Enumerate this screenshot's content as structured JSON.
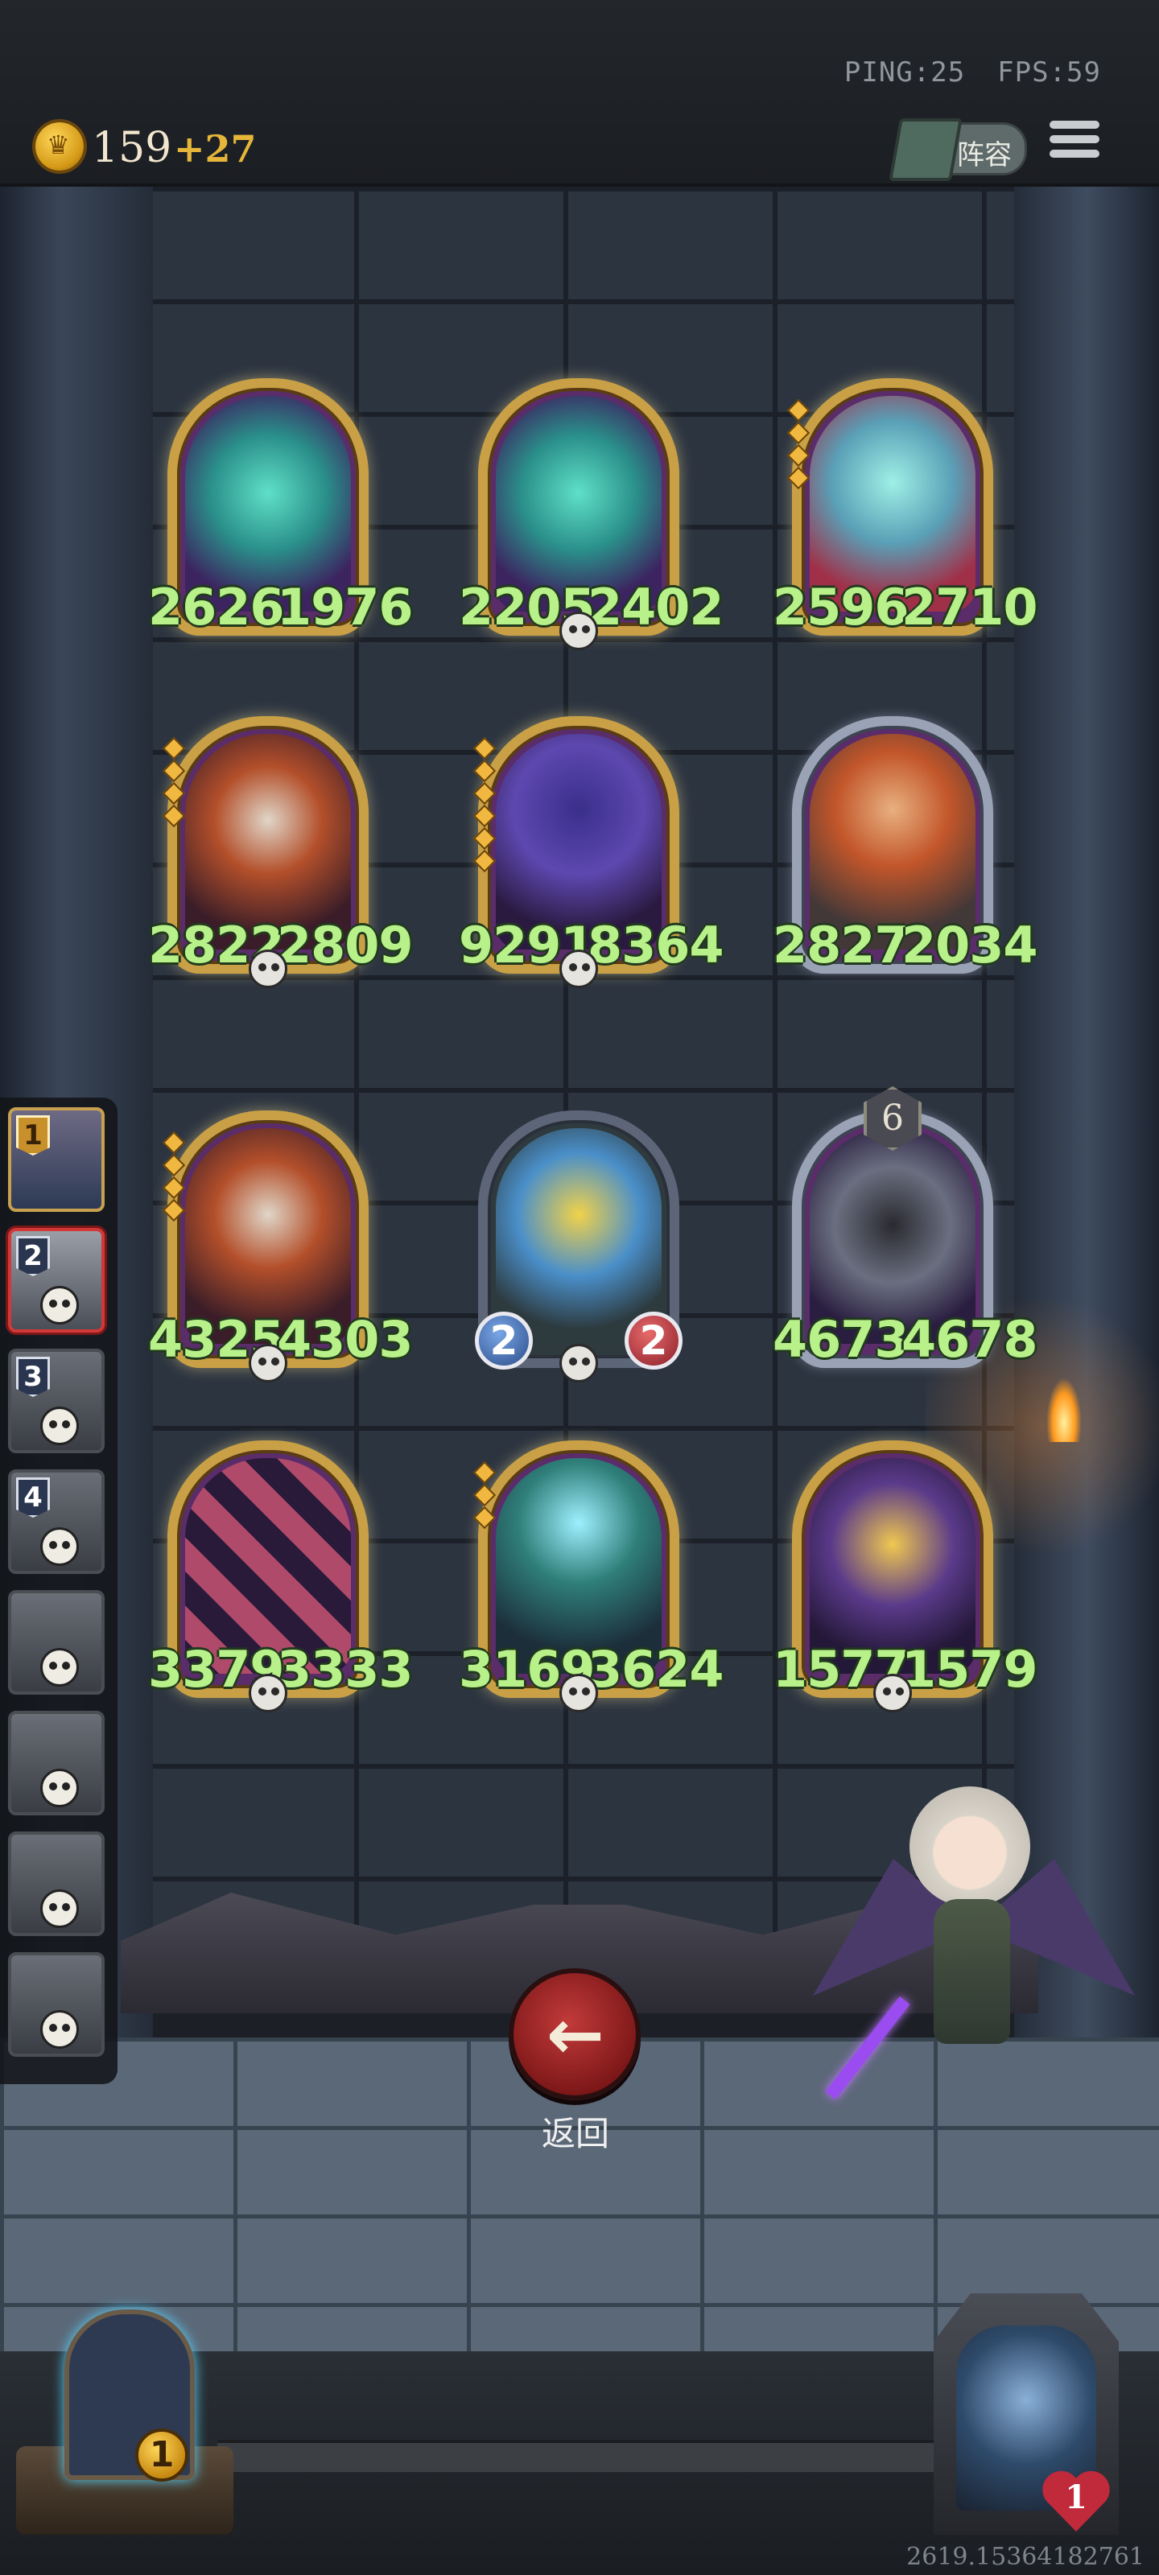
{
  "hud": {
    "ping_label": "PING:25",
    "fps_label": "FPS:59",
    "gold": "159",
    "gold_gain": "+27",
    "lineup_label": "阵容",
    "icons": {
      "coin": "crown-coin-icon",
      "lineup": "book-icon",
      "menu": "hamburger-menu-icon"
    }
  },
  "board": {
    "rows": [
      [
        {
          "name": "spectral-wolf",
          "attack": "2626",
          "health": "1976",
          "frame": "golden",
          "skull": false,
          "gems": 0
        },
        {
          "name": "spectral-wolf",
          "attack": "2205",
          "health": "2402",
          "frame": "golden",
          "skull": true,
          "gems": 0
        },
        {
          "name": "ghost-spirit",
          "attack": "2596",
          "health": "2710",
          "frame": "golden",
          "skull": false,
          "gems": 4
        }
      ],
      [
        {
          "name": "hooded-assassin",
          "attack": "2822",
          "health": "2809",
          "frame": "golden",
          "skull": true,
          "gems": 4
        },
        {
          "name": "mech-knight",
          "attack": "9291",
          "health": "8364",
          "frame": "golden",
          "skull": true,
          "gems": 6
        },
        {
          "name": "ranger",
          "attack": "2827",
          "health": "2034",
          "frame": "silver",
          "skull": false,
          "gems": 0
        }
      ],
      [
        {
          "name": "hooded-assassin",
          "attack": "4325",
          "health": "4303",
          "frame": "golden",
          "skull": true,
          "gems": 4
        },
        {
          "name": "pinocchio-puppet",
          "attack": "2",
          "health": "2",
          "frame": "plain",
          "skull": true,
          "gems": 0,
          "orbs": true
        },
        {
          "name": "shadow-beast",
          "attack": "4673",
          "health": "4678",
          "frame": "silver",
          "skull": false,
          "gems": 0,
          "tier": "6"
        }
      ],
      [
        {
          "name": "harlequin",
          "attack": "3379",
          "health": "3333",
          "frame": "golden",
          "skull": true,
          "gems": 0
        },
        {
          "name": "lantern-lich",
          "attack": "3169",
          "health": "3624",
          "frame": "golden",
          "skull": true,
          "gems": 3
        },
        {
          "name": "golden-golem",
          "attack": "1577",
          "health": "1579",
          "frame": "golden",
          "skull": true,
          "gems": 0
        }
      ]
    ]
  },
  "queue": {
    "slots": [
      {
        "number": "1",
        "state": "active"
      },
      {
        "number": "2",
        "state": "selected"
      },
      {
        "number": "3",
        "state": "eliminated"
      },
      {
        "number": "4",
        "state": "eliminated"
      },
      {
        "number": "",
        "state": "eliminated"
      },
      {
        "number": "",
        "state": "eliminated"
      },
      {
        "number": "",
        "state": "eliminated"
      },
      {
        "number": "",
        "state": "eliminated"
      }
    ]
  },
  "back_button": {
    "label": "返回",
    "icon": "arrow-left-icon"
  },
  "player": {
    "gold_badge": "1"
  },
  "opponent": {
    "health": "1"
  },
  "footer": {
    "session_id": "2619.15364182761"
  }
}
